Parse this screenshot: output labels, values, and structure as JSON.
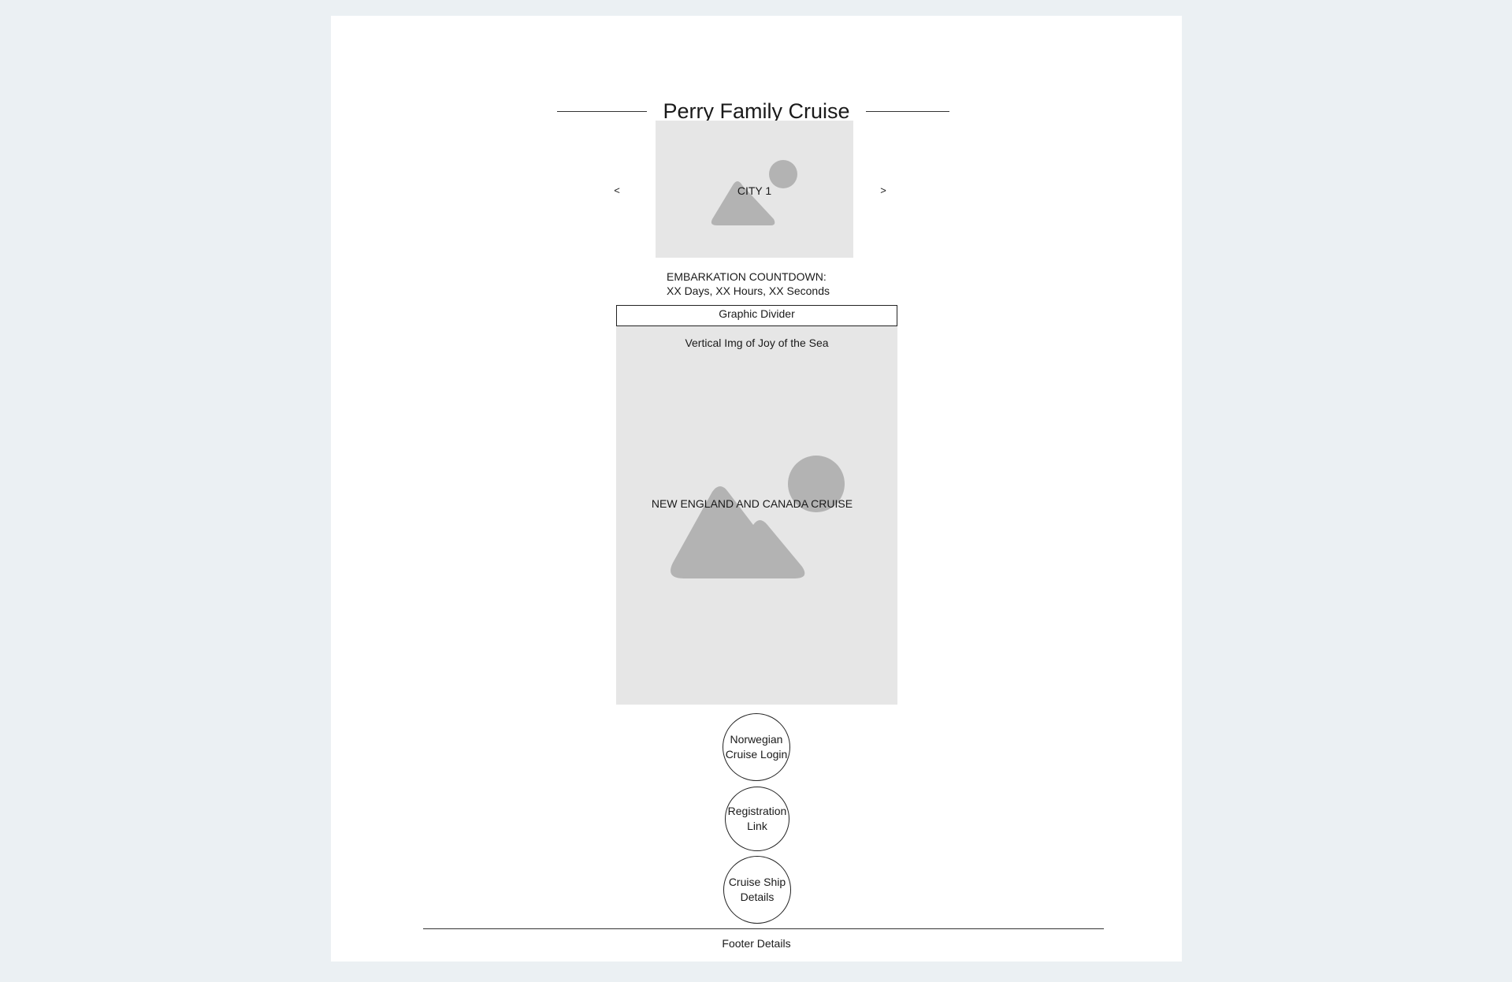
{
  "header": {
    "title": "Perry Family Cruise"
  },
  "carousel": {
    "prev_label": "<",
    "next_label": ">",
    "slide_label": "CITY 1",
    "image_icon": "image-placeholder-icon"
  },
  "countdown": {
    "label": "EMBARKATION COUNTDOWN:",
    "value": "XX Days, XX Hours, XX Seconds"
  },
  "divider": {
    "label": "Graphic Divider"
  },
  "ship_image": {
    "caption": "Vertical Img of Joy of the Sea",
    "center_label": "NEW ENGLAND AND CANADA CRUISE",
    "image_icon": "image-placeholder-icon"
  },
  "links": {
    "norwegian_login": [
      "Norwegian",
      "Cruise Login"
    ],
    "registration": [
      "Registration",
      "Link"
    ],
    "ship_details": [
      "Cruise Ship",
      "Details"
    ]
  },
  "footer": {
    "label": "Footer Details"
  },
  "colors": {
    "page_background": "#ebf0f3",
    "canvas": "#ffffff",
    "placeholder_fill": "#e6e6e6",
    "placeholder_shape": "#b3b3b3"
  }
}
